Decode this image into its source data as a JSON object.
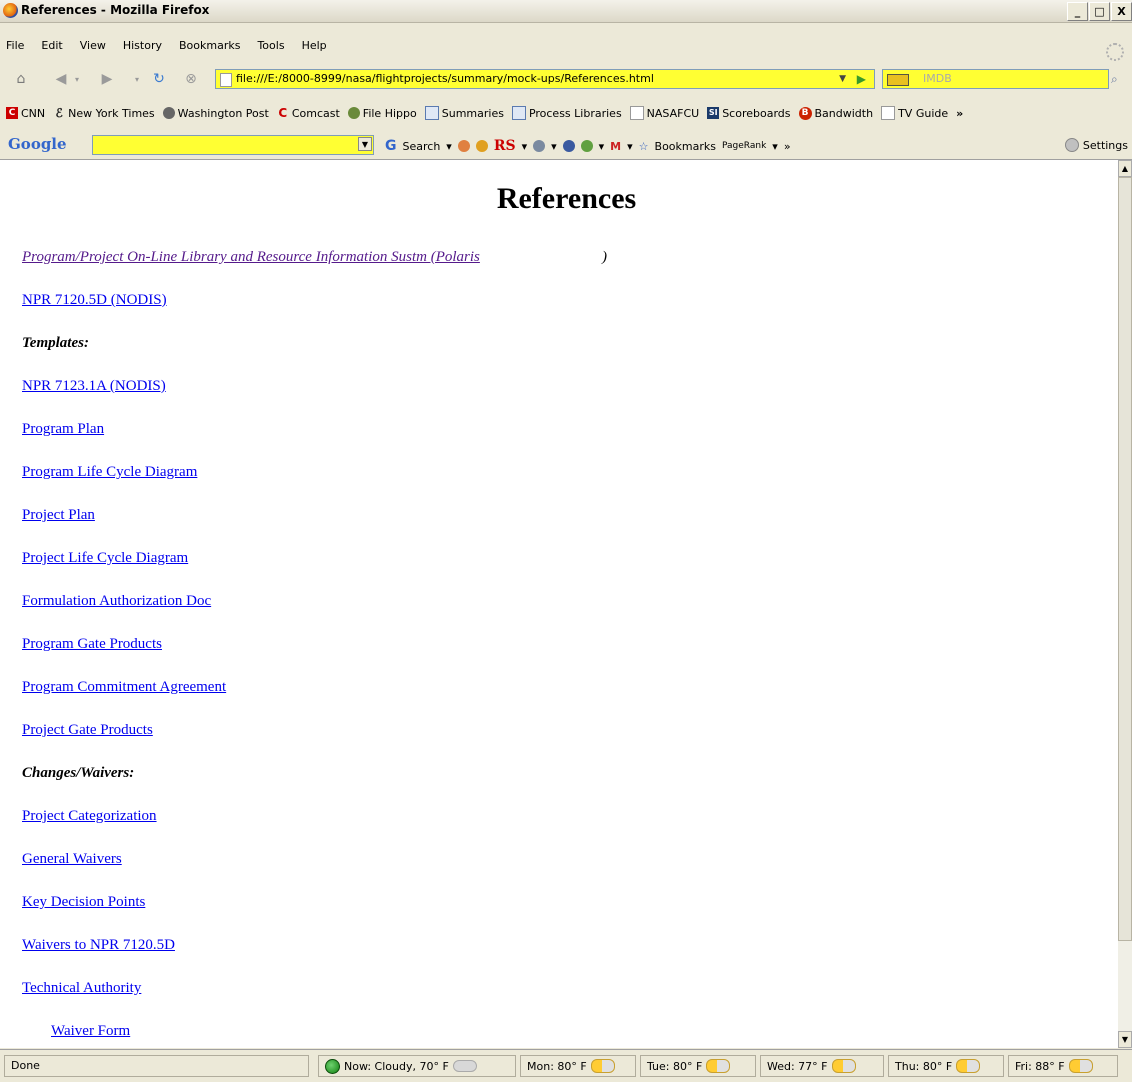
{
  "window": {
    "title": "References - Mozilla Firefox",
    "controls": [
      "_",
      "□",
      "X"
    ]
  },
  "menu": [
    "File",
    "Edit",
    "View",
    "History",
    "Bookmarks",
    "Tools",
    "Help"
  ],
  "navbar": {
    "url": "file:///E:/8000-8999/nasa/flightprojects/summary/mock-ups/References.html",
    "search_placeholder": "IMDB"
  },
  "bookmarks": [
    {
      "label": "CNN",
      "icon": "cnn-icon",
      "color": "#cc0000"
    },
    {
      "label": "New York Times",
      "icon": "nyt-icon",
      "color": "#222222"
    },
    {
      "label": "Washington Post",
      "icon": "wapo-icon",
      "color": "#444444"
    },
    {
      "label": "Comcast",
      "icon": "comcast-icon",
      "color": "#cc0000"
    },
    {
      "label": "File Hippo",
      "icon": "filehippo-icon",
      "color": "#4a6a2a"
    },
    {
      "label": "Summaries",
      "icon": "page-icon",
      "color": "#5a7ab0"
    },
    {
      "label": "Process Libraries",
      "icon": "page-icon",
      "color": "#5a7ab0"
    },
    {
      "label": "NASAFCU",
      "icon": "page-icon",
      "color": "#999999"
    },
    {
      "label": "Scoreboards",
      "icon": "si-icon",
      "color": "#1a3a6a"
    },
    {
      "label": "Bandwidth",
      "icon": "bandwidth-icon",
      "color": "#cc2200"
    },
    {
      "label": "TV Guide",
      "icon": "page-icon",
      "color": "#999999"
    }
  ],
  "google_toolbar": {
    "logo": "Google",
    "search_label": "Search",
    "rs_label": "RS",
    "bookmarks_label": "Bookmarks",
    "pagerank_label": "PageRank",
    "settings_label": "Settings"
  },
  "page": {
    "title": "References",
    "items": [
      {
        "type": "link-italic",
        "text": "Program/Project On-Line Library and Resource Information Sustm (Polaris",
        "after": ")"
      },
      {
        "type": "link",
        "text": "NPR 7120.5D (NODIS)"
      },
      {
        "type": "heading",
        "text": "Templates:"
      },
      {
        "type": "link",
        "text": "NPR 7123.1A (NODIS)"
      },
      {
        "type": "link",
        "text": "Program Plan"
      },
      {
        "type": "link",
        "text": "Program Life Cycle Diagram"
      },
      {
        "type": "link",
        "text": "Project Plan"
      },
      {
        "type": "link",
        "text": "Project Life Cycle Diagram"
      },
      {
        "type": "link",
        "text": "Formulation Authorization Doc"
      },
      {
        "type": "link",
        "text": "Program Gate Products"
      },
      {
        "type": "link",
        "text": "Program Commitment Agreement"
      },
      {
        "type": "link",
        "text": "Project Gate Products"
      },
      {
        "type": "heading",
        "text": "Changes/Waivers:"
      },
      {
        "type": "link",
        "text": "Project Categorization"
      },
      {
        "type": "link",
        "text": "General Waivers"
      },
      {
        "type": "link",
        "text": "Key Decision Points"
      },
      {
        "type": "link",
        "text": "Waivers to NPR 7120.5D"
      },
      {
        "type": "link",
        "text": "Technical Authority"
      },
      {
        "type": "link-indent",
        "text": "Waiver Form"
      }
    ]
  },
  "status": {
    "text": "Done",
    "weather": [
      {
        "label": "Now: Cloudy, 70° F",
        "icon": "cloud-icon"
      },
      {
        "label": "Mon: 80° F",
        "icon": "sun-cloud-icon"
      },
      {
        "label": "Tue: 80° F",
        "icon": "sun-cloud-icon"
      },
      {
        "label": "Wed: 77° F",
        "icon": "sun-cloud-icon"
      },
      {
        "label": "Thu: 80° F",
        "icon": "sun-cloud-icon"
      },
      {
        "label": "Fri: 88° F",
        "icon": "sun-cloud-icon"
      }
    ]
  }
}
